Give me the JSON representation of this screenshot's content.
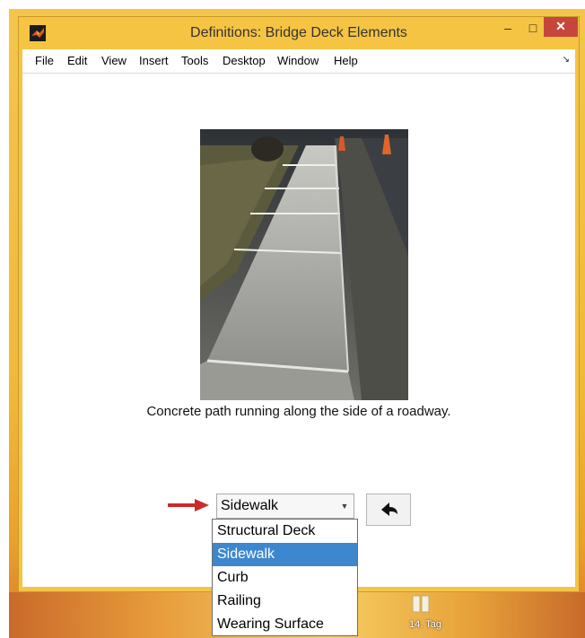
{
  "window": {
    "title": "Definitions: Bridge Deck Elements",
    "min_glyph": "–",
    "max_glyph": "□",
    "close_glyph": "✕",
    "close_color": "#c7463c"
  },
  "menubar": {
    "items": [
      "File",
      "Edit",
      "View",
      "Insert",
      "Tools",
      "Desktop",
      "Window",
      "Help"
    ],
    "toolbar_toggle_glyph": "↘"
  },
  "content": {
    "image_subject": "sidewalk-photo",
    "caption": "Concrete path running along the side of a roadway."
  },
  "selector": {
    "value": "Sidewalk",
    "options": [
      "Structural Deck",
      "Sidewalk",
      "Curb",
      "Railing",
      "Wearing Surface"
    ],
    "selected_index": 1,
    "highlight_color": "#3d87cf"
  },
  "back_button": {
    "icon": "back-arrow-icon"
  },
  "annotation_arrow_color": "#cc2a2a",
  "desktop": {
    "icon_label": "14. Tag"
  }
}
